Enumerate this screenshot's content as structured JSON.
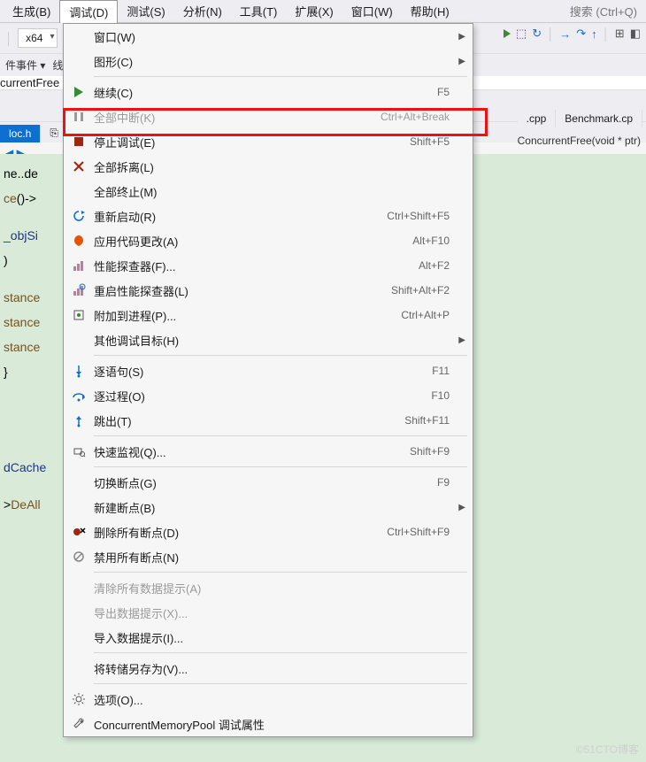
{
  "menubar": {
    "items": [
      "生成(B)",
      "调试(D)",
      "测试(S)",
      "分析(N)",
      "工具(T)",
      "扩展(X)",
      "窗口(W)",
      "帮助(H)"
    ],
    "active_index": 1,
    "search_placeholder": "搜索 (Ctrl+Q)"
  },
  "toolbar": {
    "platform": "x64"
  },
  "breadcrumb": {
    "events_label": "件事件 ▾",
    "thread_label": "线",
    "right_label": "currentFree"
  },
  "tabs": {
    "left_active": "loc.h",
    "right_cpp": ".cpp",
    "right_bench": "Benchmark.cp"
  },
  "subcrumb_right": "ConcurrentFree(void * ptr)",
  "code": {
    "l1": "ne..de",
    "l2a": "ce",
    "l2b": "()->",
    "l3": "_objSi",
    "l4": ")",
    "l5": "stance",
    "l6": "stance",
    "l7": "stance",
    "l8": "}",
    "l9": "dCache",
    "l10a": ">",
    "l10b": "DeAll"
  },
  "menu": {
    "groups": [
      [
        {
          "icon": "",
          "label": "窗口(W)",
          "shortcut": "",
          "submenu": true
        },
        {
          "icon": "",
          "label": "图形(C)",
          "shortcut": "",
          "submenu": true
        }
      ],
      [
        {
          "icon": "play",
          "label": "继续(C)",
          "shortcut": "F5"
        },
        {
          "icon": "pause",
          "label": "全部中断(K)",
          "shortcut": "Ctrl+Alt+Break",
          "disabled": true
        },
        {
          "icon": "stop",
          "label": "停止调试(E)",
          "shortcut": "Shift+F5"
        },
        {
          "icon": "detach",
          "label": "全部拆离(L)",
          "shortcut": ""
        },
        {
          "icon": "",
          "label": "全部终止(M)",
          "shortcut": ""
        },
        {
          "icon": "restart",
          "label": "重新启动(R)",
          "shortcut": "Ctrl+Shift+F5"
        },
        {
          "icon": "apply",
          "label": "应用代码更改(A)",
          "shortcut": "Alt+F10"
        },
        {
          "icon": "perf",
          "label": "性能探查器(F)...",
          "shortcut": "Alt+F2"
        },
        {
          "icon": "perf2",
          "label": "重启性能探查器(L)",
          "shortcut": "Shift+Alt+F2"
        },
        {
          "icon": "attach",
          "label": "附加到进程(P)...",
          "shortcut": "Ctrl+Alt+P"
        },
        {
          "icon": "",
          "label": "其他调试目标(H)",
          "shortcut": "",
          "submenu": true
        }
      ],
      [
        {
          "icon": "stepinto",
          "label": "逐语句(S)",
          "shortcut": "F11"
        },
        {
          "icon": "stepover",
          "label": "逐过程(O)",
          "shortcut": "F10"
        },
        {
          "icon": "stepout",
          "label": "跳出(T)",
          "shortcut": "Shift+F11"
        }
      ],
      [
        {
          "icon": "watch",
          "label": "快速监视(Q)...",
          "shortcut": "Shift+F9"
        }
      ],
      [
        {
          "icon": "",
          "label": "切换断点(G)",
          "shortcut": "F9"
        },
        {
          "icon": "",
          "label": "新建断点(B)",
          "shortcut": "",
          "submenu": true
        },
        {
          "icon": "delbp",
          "label": "删除所有断点(D)",
          "shortcut": "Ctrl+Shift+F9"
        },
        {
          "icon": "disbp",
          "label": "禁用所有断点(N)",
          "shortcut": ""
        }
      ],
      [
        {
          "icon": "",
          "label": "清除所有数据提示(A)",
          "shortcut": "",
          "disabled": true
        },
        {
          "icon": "",
          "label": "导出数据提示(X)...",
          "shortcut": "",
          "disabled": true
        },
        {
          "icon": "",
          "label": "导入数据提示(I)...",
          "shortcut": ""
        }
      ],
      [
        {
          "icon": "",
          "label": "将转储另存为(V)...",
          "shortcut": ""
        }
      ],
      [
        {
          "icon": "gear",
          "label": "选项(O)...",
          "shortcut": ""
        },
        {
          "icon": "wrench",
          "label": "ConcurrentMemoryPool 调试属性",
          "shortcut": ""
        }
      ]
    ]
  },
  "watermark": "©51CTO博客"
}
